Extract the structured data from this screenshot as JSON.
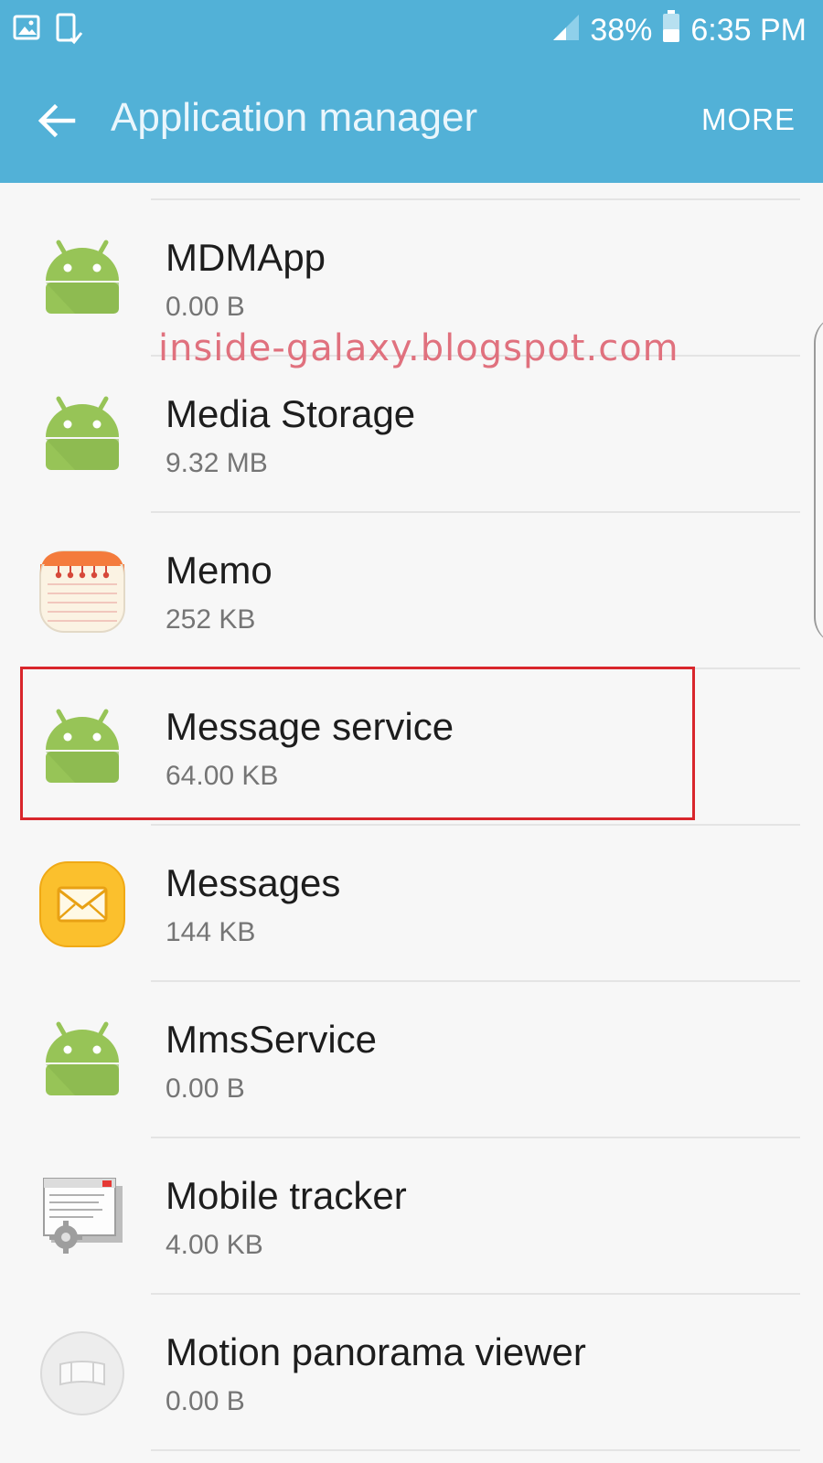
{
  "status_bar": {
    "battery": "38%",
    "time": "6:35 PM",
    "icons": [
      "gallery-icon",
      "device-check-icon",
      "signal-icon",
      "battery-icon"
    ]
  },
  "toolbar": {
    "title": "Application manager",
    "more_label": "MORE",
    "background": "#52b1d7"
  },
  "watermark": "inside-galaxy.blogspot.com",
  "apps": [
    {
      "name": "MDMApp",
      "size": "0.00 B",
      "icon": "android-icon"
    },
    {
      "name": "Media Storage",
      "size": "9.32 MB",
      "icon": "android-icon"
    },
    {
      "name": "Memo",
      "size": "252 KB",
      "icon": "memo-icon"
    },
    {
      "name": "Message service",
      "size": "64.00 KB",
      "icon": "android-icon"
    },
    {
      "name": "Messages",
      "size": "144 KB",
      "icon": "messages-icon"
    },
    {
      "name": "MmsService",
      "size": "0.00 B",
      "icon": "android-icon"
    },
    {
      "name": "Mobile tracker",
      "size": "4.00 KB",
      "icon": "mobile-tracker-icon"
    },
    {
      "name": "Motion panorama viewer",
      "size": "0.00 B",
      "icon": "panorama-icon"
    }
  ],
  "highlight_color": "#d9262c"
}
